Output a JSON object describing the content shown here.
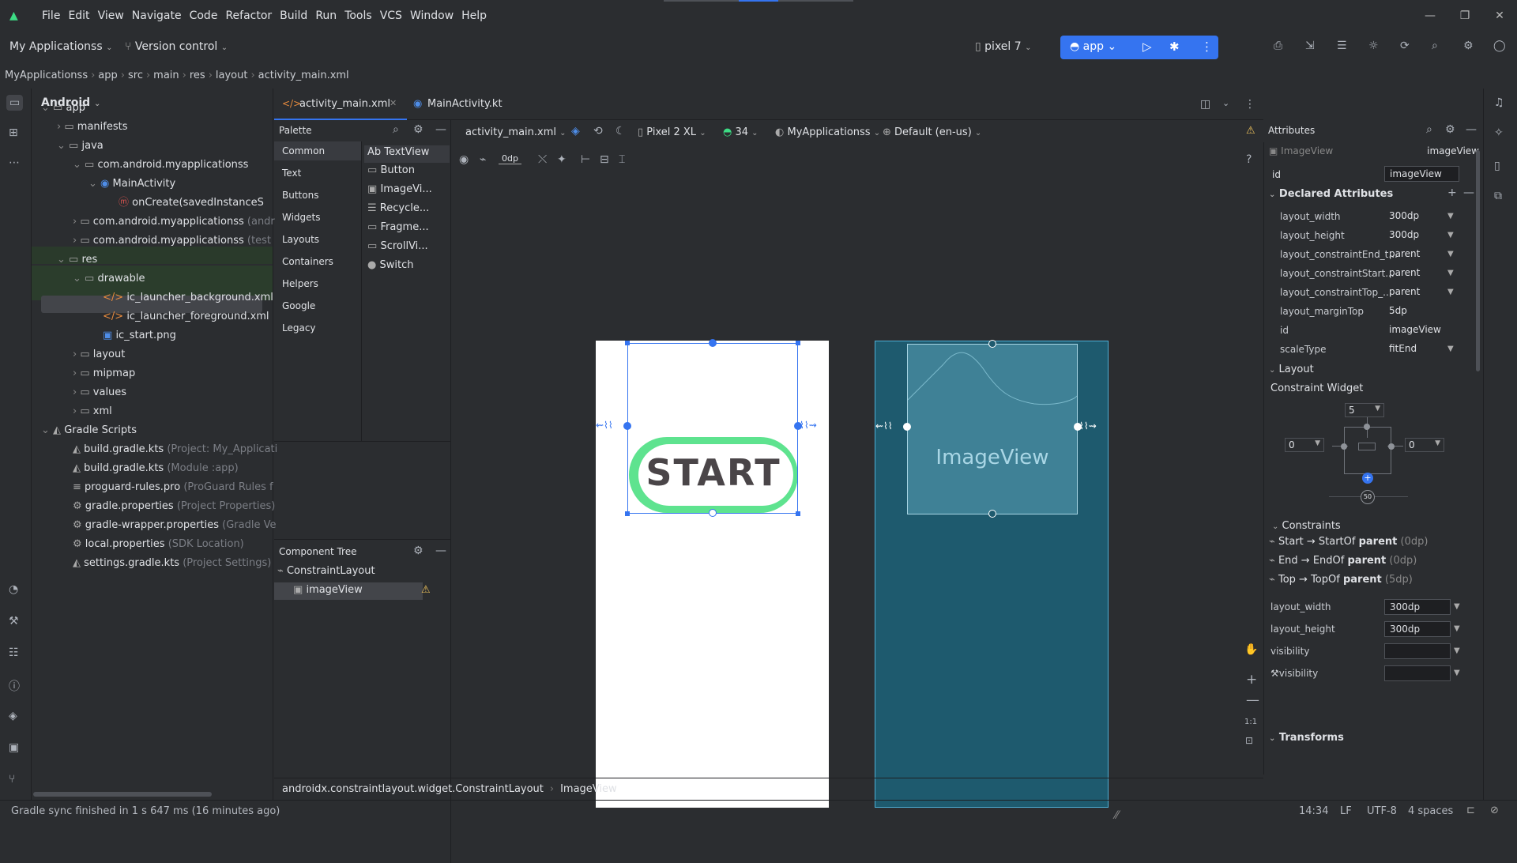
{
  "menu": [
    "File",
    "Edit",
    "View",
    "Navigate",
    "Code",
    "Refactor",
    "Build",
    "Run",
    "Tools",
    "VCS",
    "Window",
    "Help"
  ],
  "toolbar": {
    "project": "My Applicationss",
    "vcs": "Version control",
    "device": "pixel 7",
    "run_config": "app"
  },
  "breadcrumbs": [
    "MyApplicationss",
    "app",
    "src",
    "main",
    "res",
    "layout",
    "activity_main.xml"
  ],
  "project_panel": {
    "view_mode": "Android",
    "items": [
      {
        "label": "app",
        "extra": ""
      },
      {
        "label": "manifests",
        "extra": ""
      },
      {
        "label": "java",
        "extra": ""
      },
      {
        "label": "com.android.myapplicationss",
        "extra": ""
      },
      {
        "label": "MainActivity",
        "extra": ""
      },
      {
        "label": "onCreate(savedInstanceS",
        "extra": ""
      },
      {
        "label": "com.android.myapplicationss",
        "extra": "(andr"
      },
      {
        "label": "com.android.myapplicationss",
        "extra": "(test"
      },
      {
        "label": "res",
        "extra": ""
      },
      {
        "label": "drawable",
        "extra": ""
      },
      {
        "label": "ic_launcher_background.xml",
        "extra": ""
      },
      {
        "label": "ic_launcher_foreground.xml",
        "extra": ""
      },
      {
        "label": "ic_start.png",
        "extra": ""
      },
      {
        "label": "layout",
        "extra": ""
      },
      {
        "label": "mipmap",
        "extra": ""
      },
      {
        "label": "values",
        "extra": ""
      },
      {
        "label": "xml",
        "extra": ""
      },
      {
        "label": "Gradle Scripts",
        "extra": ""
      },
      {
        "label": "build.gradle.kts",
        "extra": "(Project: My_Applicati"
      },
      {
        "label": "build.gradle.kts",
        "extra": "(Module :app)"
      },
      {
        "label": "proguard-rules.pro",
        "extra": "(ProGuard Rules f"
      },
      {
        "label": "gradle.properties",
        "extra": "(Project Properties)"
      },
      {
        "label": "gradle-wrapper.properties",
        "extra": "(Gradle Ve"
      },
      {
        "label": "local.properties",
        "extra": "(SDK Location)"
      },
      {
        "label": "settings.gradle.kts",
        "extra": "(Project Settings)"
      }
    ]
  },
  "tabs": [
    {
      "label": "activity_main.xml"
    },
    {
      "label": "MainActivity.kt"
    }
  ],
  "palette": {
    "title": "Palette",
    "categories": [
      "Common",
      "Text",
      "Buttons",
      "Widgets",
      "Layouts",
      "Containers",
      "Helpers",
      "Google",
      "Legacy"
    ],
    "items": [
      "TextView",
      "Button",
      "ImageVi...",
      "Recycle...",
      "Fragme...",
      "ScrollVi...",
      "Switch"
    ]
  },
  "component_tree": {
    "title": "Component Tree",
    "root": "ConstraintLayout",
    "child": "imageView"
  },
  "design_toolbar": {
    "file": "activity_main.xml",
    "device": "Pixel 2 XL",
    "api": "34",
    "theme": "MyApplicationss",
    "locale": "Default (en-us)",
    "margin": "0dp"
  },
  "preview": {
    "button_text": "START",
    "blueprint_label": "ImageView"
  },
  "attributes": {
    "title": "Attributes",
    "widget_type": "ImageView",
    "widget_id": "imageView",
    "id_label": "id",
    "id_value": "imageView",
    "declared_title": "Declared Attributes",
    "declared": [
      {
        "k": "layout_width",
        "v": "300dp"
      },
      {
        "k": "layout_height",
        "v": "300dp"
      },
      {
        "k": "layout_constraintEnd_t...",
        "v": "parent"
      },
      {
        "k": "layout_constraintStart...",
        "v": "parent"
      },
      {
        "k": "layout_constraintTop_...",
        "v": "parent"
      },
      {
        "k": "layout_marginTop",
        "v": "5dp"
      },
      {
        "k": "id",
        "v": "imageView"
      },
      {
        "k": "scaleType",
        "v": "fitEnd"
      }
    ],
    "layout_title": "Layout",
    "constraint_widget": "Constraint Widget",
    "margin_top": "5",
    "margin_start": "0",
    "margin_end": "0",
    "bias": "50",
    "constraints_title": "Constraints",
    "constraints": [
      {
        "a": "Start → StartOf ",
        "b": "parent",
        "c": "(0dp)"
      },
      {
        "a": "End → EndOf ",
        "b": "parent",
        "c": "(0dp)"
      },
      {
        "a": "Top → TopOf ",
        "b": "parent",
        "c": "(5dp)"
      }
    ],
    "layout_fields": [
      {
        "k": "layout_width",
        "v": "300dp"
      },
      {
        "k": "layout_height",
        "v": "300dp"
      },
      {
        "k": "visibility",
        "v": ""
      },
      {
        "k": "visibility",
        "v": ""
      }
    ],
    "transforms_title": "Transforms"
  },
  "path_bar": [
    "androidx.constraintlayout.widget.ConstraintLayout",
    "ImageView"
  ],
  "status": {
    "message": "Gradle sync finished in 1 s 647 ms (16 minutes ago)",
    "position": "14:34",
    "line_sep": "LF",
    "encoding": "UTF-8",
    "indent": "4 spaces"
  },
  "colors": {
    "accent": "#3574f0",
    "blueprint": "#1e5a6e",
    "selection": "#2e436e"
  }
}
